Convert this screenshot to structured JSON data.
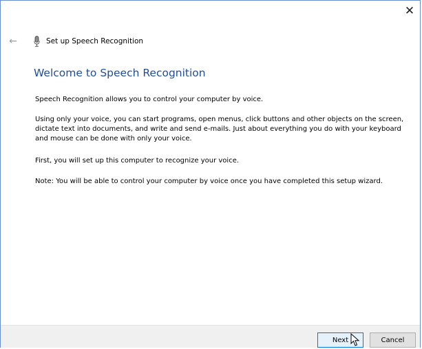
{
  "window": {
    "close_glyph": "✕"
  },
  "header": {
    "back_glyph": "←",
    "icon": "microphone-icon",
    "title": "Set up Speech Recognition"
  },
  "content": {
    "heading": "Welcome to Speech Recognition",
    "paragraphs": [
      "Speech Recognition allows you to control your computer by voice.",
      "Using only your voice, you can start programs, open menus, click buttons and other objects on the screen, dictate text into documents, and write and send e-mails. Just about everything you do with your keyboard and mouse can be done with only your voice.",
      "First, you will set up this computer to recognize your voice.",
      "Note: You will be able to control your computer by voice once you have completed this setup wizard."
    ]
  },
  "footer": {
    "next_label": "Next",
    "cancel_label": "Cancel"
  },
  "colors": {
    "heading": "#1e4e9c",
    "window_border": "#6a8fc6",
    "footer_bg": "#f0f0f0",
    "default_button_border": "#0078d7"
  }
}
